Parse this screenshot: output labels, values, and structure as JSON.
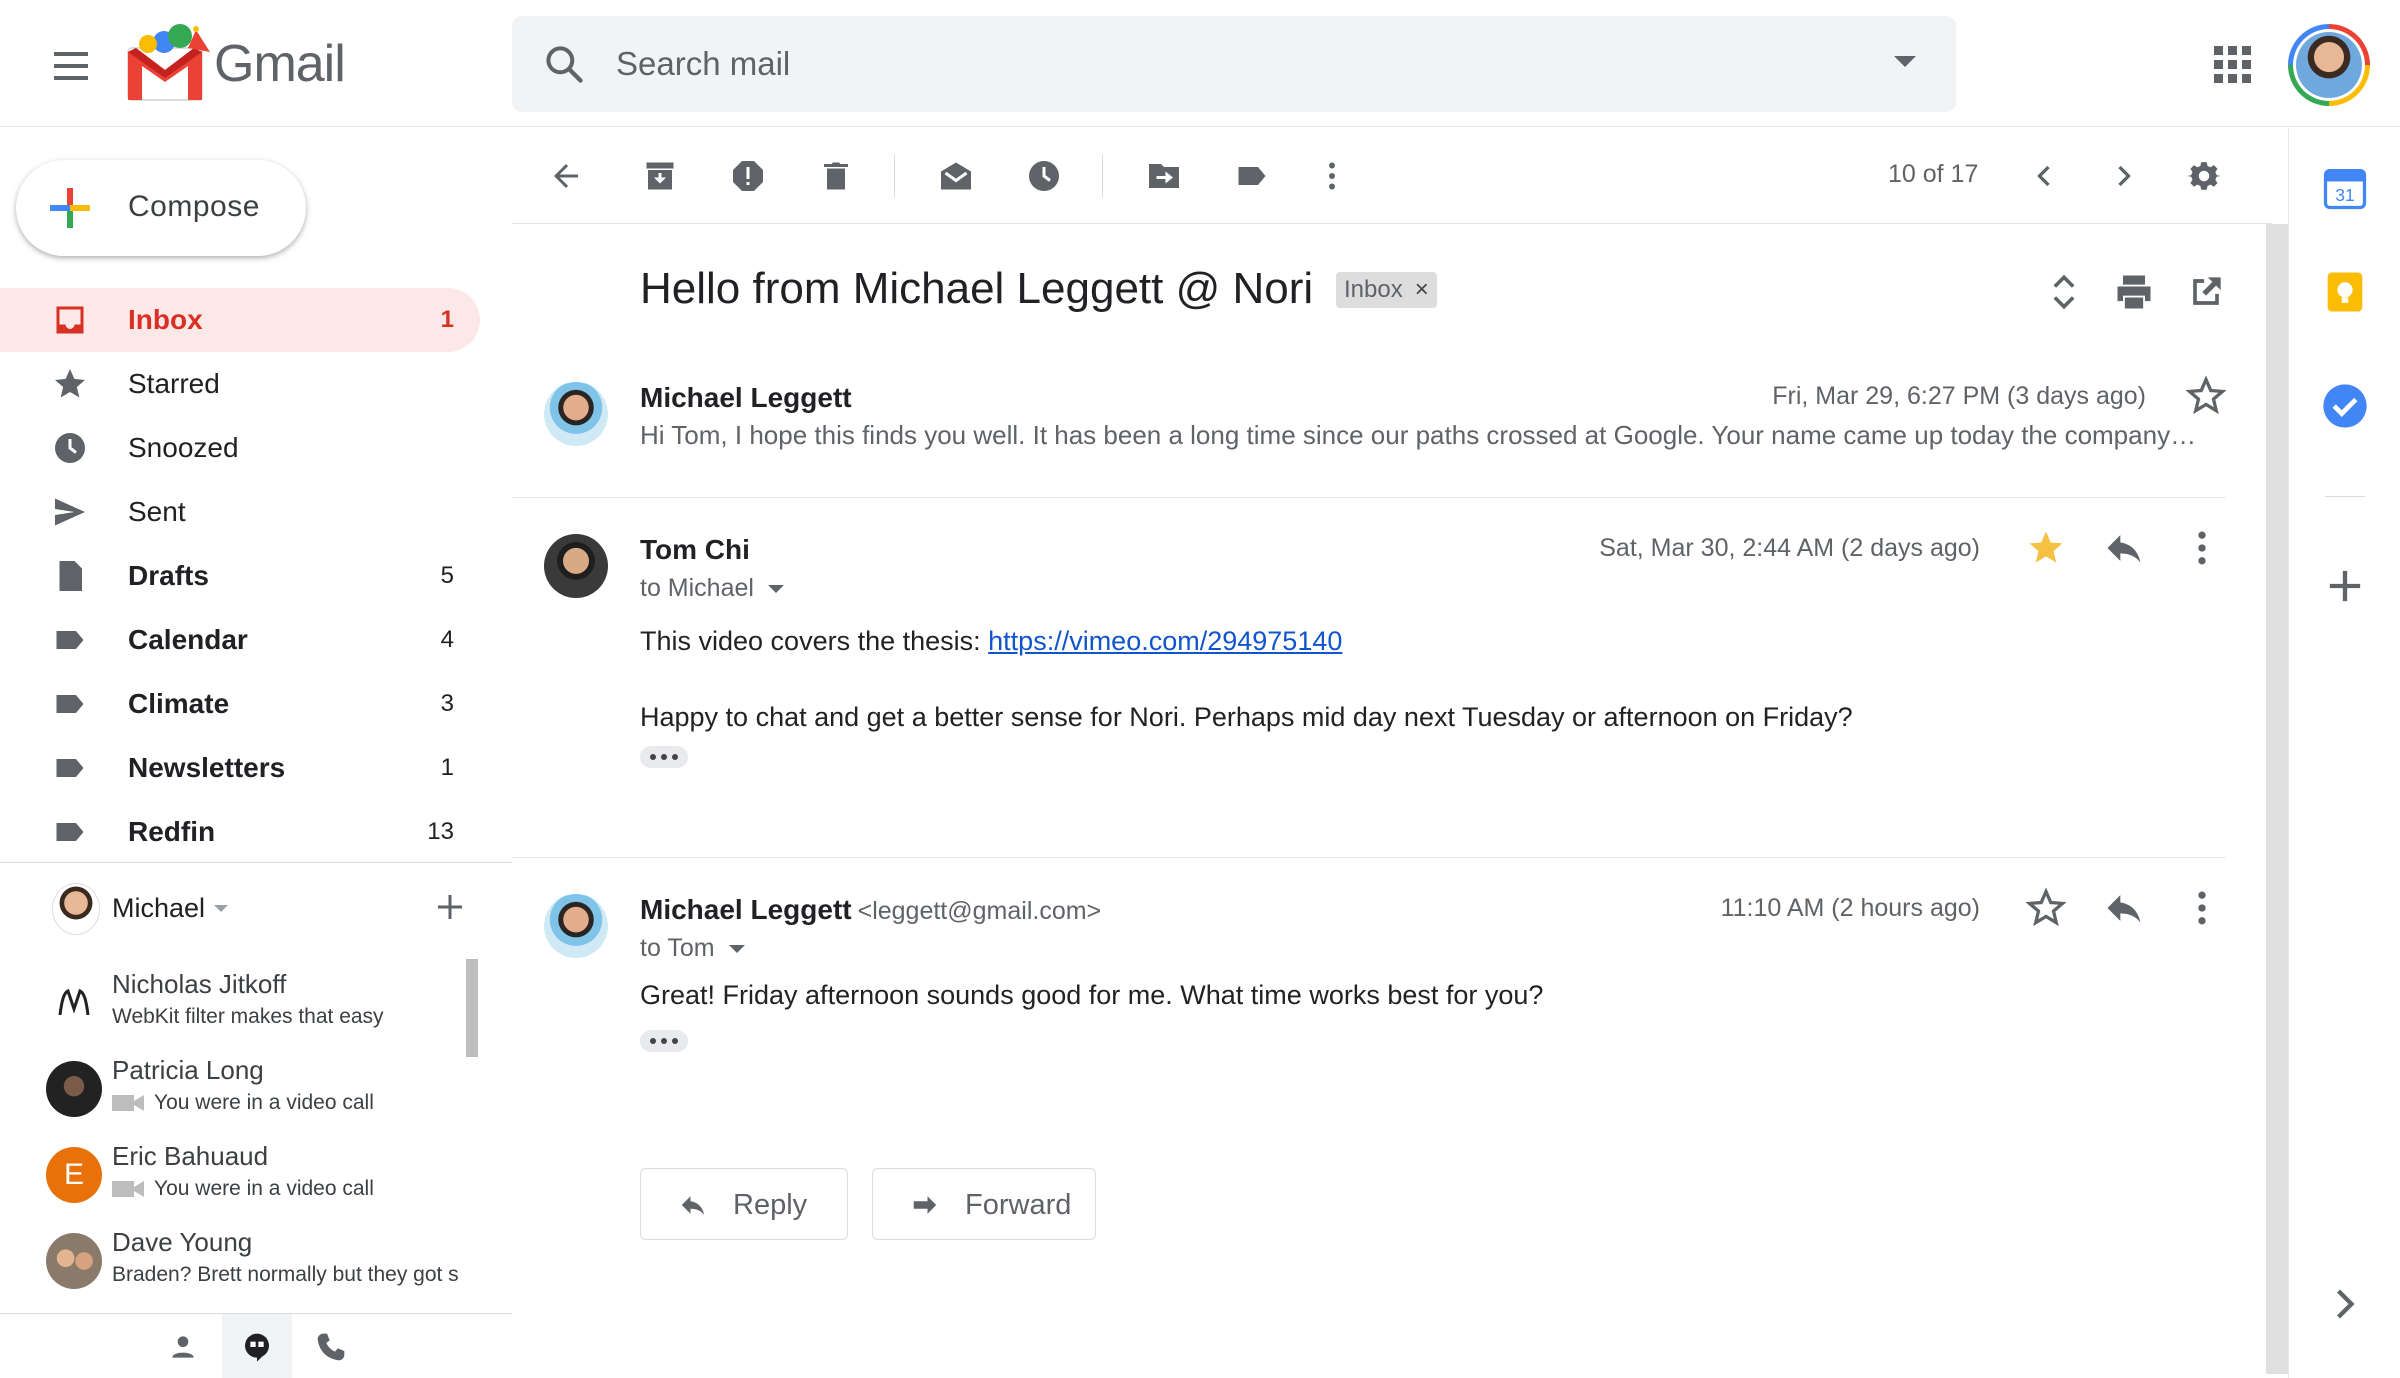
{
  "app": {
    "logo_text": "Gmail"
  },
  "search": {
    "placeholder": "Search mail"
  },
  "compose": {
    "label": "Compose"
  },
  "nav": [
    {
      "label": "Inbox",
      "count": "1",
      "icon": "inbox-icon",
      "active": true
    },
    {
      "label": "Starred",
      "count": "",
      "icon": "star-icon"
    },
    {
      "label": "Snoozed",
      "count": "",
      "icon": "clock-icon"
    },
    {
      "label": "Sent",
      "count": "",
      "icon": "send-icon"
    },
    {
      "label": "Drafts",
      "count": "5",
      "icon": "draft-icon"
    },
    {
      "label": "Calendar",
      "count": "4",
      "icon": "label-icon"
    },
    {
      "label": "Climate",
      "count": "3",
      "icon": "label-icon"
    },
    {
      "label": "Newsletters",
      "count": "1",
      "icon": "label-icon"
    },
    {
      "label": "Redfin",
      "count": "13",
      "icon": "label-icon"
    }
  ],
  "hangouts": {
    "me": "Michael",
    "contacts": [
      {
        "name": "Nicholas Jitkoff",
        "status": "WebKit filter makes that easy",
        "video": false
      },
      {
        "name": "Patricia Long",
        "status": "You were in a video call",
        "video": true
      },
      {
        "name": "Eric Bahuaud",
        "status": "You were in a video call",
        "video": true,
        "initial": "E"
      },
      {
        "name": "Dave Young",
        "status": "Braden? Brett normally but they got s",
        "video": false
      }
    ]
  },
  "toolbar": {
    "pager": "10 of 17"
  },
  "thread": {
    "subject": "Hello from Michael Leggett @ Nori",
    "label": "Inbox",
    "label_remove": "×",
    "messages": [
      {
        "sender": "Michael Leggett",
        "date": "Fri, Mar 29, 6:27 PM (3 days ago)",
        "snippet": "Hi Tom, I hope this finds you well. It has been a long time since our paths crossed at Google. Your name came up today the company I'm at is working on",
        "starred": false
      },
      {
        "sender": "Tom Chi",
        "recipient": "to Michael",
        "date": "Sat, Mar 30, 2:44 AM (2 days ago)",
        "body_line1_prefix": "This video covers the thesis: ",
        "body_line1_link": "https://vimeo.com/294975140",
        "body_line2": "Happy to chat and get a better sense for Nori.  Perhaps mid day next Tuesday or afternoon on Friday?",
        "starred": true
      },
      {
        "sender": "Michael Leggett",
        "sender_email": "<leggett@gmail.com>",
        "recipient": "to Tom",
        "date": "11:10 AM (2 hours ago)",
        "body_line1": "Great! Friday afternoon sounds good for me. What time works best for you?",
        "starred": false
      }
    ]
  },
  "actions": {
    "reply": "Reply",
    "forward": "Forward"
  },
  "colors": {
    "accent_red": "#d93025",
    "star_yellow": "#f4c145",
    "link_blue": "#1155cc",
    "active_bg": "#fce8e6"
  }
}
